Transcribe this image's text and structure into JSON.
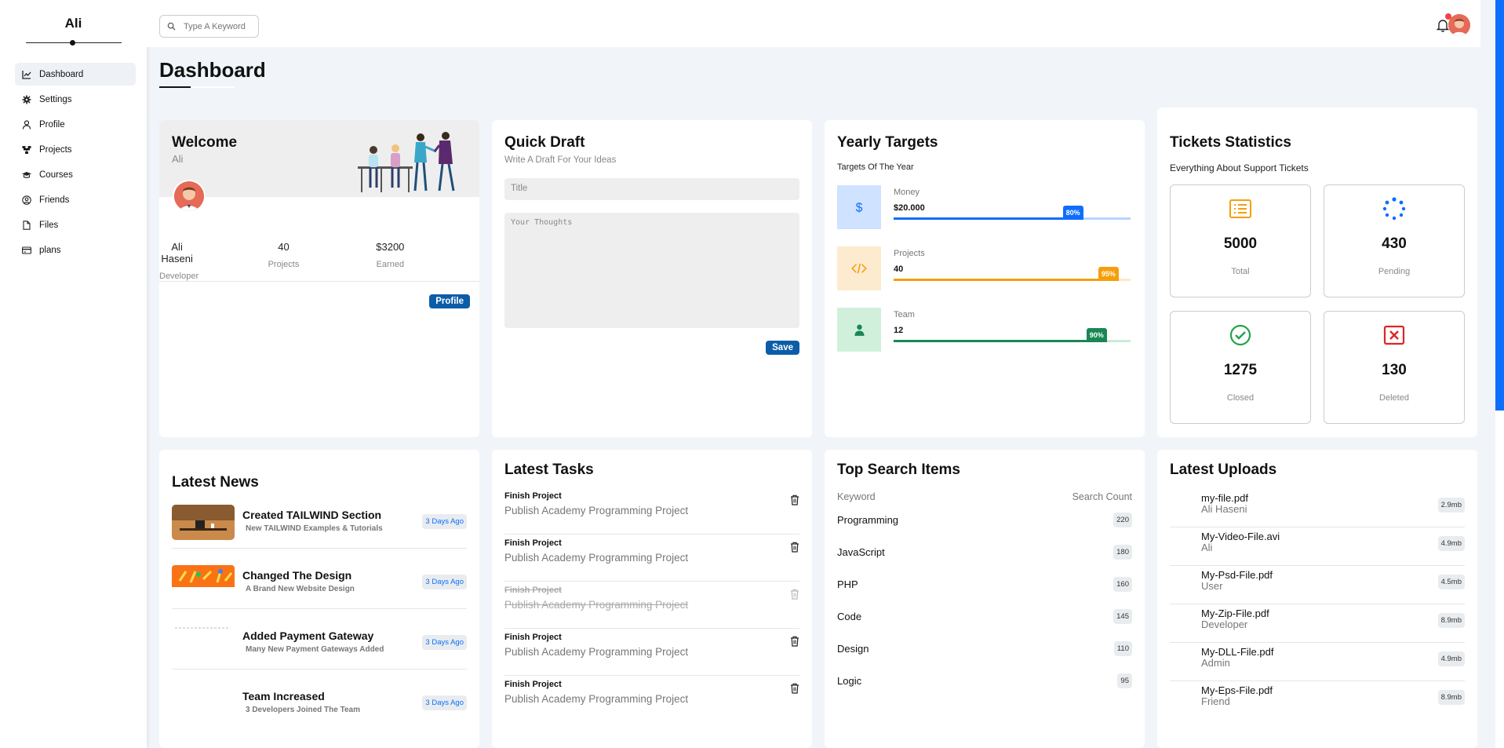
{
  "brand": {
    "name": "Ali"
  },
  "sidebar": {
    "items": [
      {
        "label": "Dashboard",
        "icon": "chart-line-icon",
        "active": true
      },
      {
        "label": "Settings",
        "icon": "gear-icon"
      },
      {
        "label": "Profile",
        "icon": "user-icon"
      },
      {
        "label": "Projects",
        "icon": "diagram-icon"
      },
      {
        "label": "Courses",
        "icon": "graduation-cap-icon"
      },
      {
        "label": "Friends",
        "icon": "user-circle-icon"
      },
      {
        "label": "Files",
        "icon": "file-icon"
      },
      {
        "label": "plans",
        "icon": "credit-card-icon"
      }
    ]
  },
  "header": {
    "search_placeholder": "Type A Keyword",
    "notification_badge": true
  },
  "page": {
    "title": "Dashboard"
  },
  "welcome": {
    "title": "Welcome",
    "subtitle": "Ali",
    "stats": [
      {
        "value": "Ali Haseni",
        "label": "Developer"
      },
      {
        "value": "40",
        "label": "Projects"
      },
      {
        "value": "$3200",
        "label": "Earned"
      }
    ],
    "button": "Profile"
  },
  "quick_draft": {
    "title": "Quick Draft",
    "subtitle": "Write A Draft For Your Ideas",
    "title_placeholder": "Title",
    "body_placeholder": "Your Thoughts",
    "button": "Save"
  },
  "targets": {
    "title": "Yearly Targets",
    "subtitle": "Targets Of The Year",
    "items": [
      {
        "name": "Money",
        "value": "$20.000",
        "percent": 80,
        "percent_label": "80%",
        "color": "#0d6efd",
        "track": "#b6d4fe",
        "bg": "#cfe2ff",
        "icon": "dollar-icon"
      },
      {
        "name": "Projects",
        "value": "40",
        "percent": 95,
        "percent_label": "95%",
        "color": "#f59e0b",
        "track": "#fde8c2",
        "bg": "#fdebd0",
        "icon": "code-icon"
      },
      {
        "name": "Team",
        "value": "12",
        "percent": 90,
        "percent_label": "90%",
        "color": "#198754",
        "track": "#c9ecd6",
        "bg": "#d1f0dc",
        "icon": "user-icon"
      }
    ]
  },
  "tickets": {
    "title": "Tickets Statistics",
    "subtitle": "Everything About Support Tickets",
    "items": [
      {
        "value": "5000",
        "label": "Total",
        "icon": "list-icon",
        "color": "#f59e0b"
      },
      {
        "value": "430",
        "label": "Pending",
        "icon": "spinner-icon",
        "color": "#0d6efd"
      },
      {
        "value": "1275",
        "label": "Closed",
        "icon": "check-circle-icon",
        "color": "#22a34a"
      },
      {
        "value": "130",
        "label": "Deleted",
        "icon": "x-square-icon",
        "color": "#dc2626"
      }
    ]
  },
  "news": {
    "title": "Latest News",
    "items": [
      {
        "title": "Created TAILWIND Section",
        "desc": "New TAILWIND Examples & Tutorials",
        "time": "3 Days Ago",
        "image": "desk-photo"
      },
      {
        "title": "Changed The Design",
        "desc": "A Brand New Website Design",
        "time": "3 Days Ago",
        "image": "orange-tools-photo"
      },
      {
        "title": "Added Payment Gateway",
        "desc": "Many New Payment Gateways Added",
        "time": "3 Days Ago",
        "image": "blank"
      },
      {
        "title": "Team Increased",
        "desc": "3 Developers Joined The Team",
        "time": "3 Days Ago",
        "image": "blank"
      }
    ]
  },
  "tasks": {
    "title": "Latest Tasks",
    "items": [
      {
        "title": "Finish Project",
        "desc": "Publish Academy Programming Project",
        "done": false
      },
      {
        "title": "Finish Project",
        "desc": "Publish Academy Programming Project",
        "done": false
      },
      {
        "title": "Finish Project",
        "desc": "Publish Academy Programming Project",
        "done": true
      },
      {
        "title": "Finish Project",
        "desc": "Publish Academy Programming Project",
        "done": false
      },
      {
        "title": "Finish Project",
        "desc": "Publish Academy Programming Project",
        "done": false
      }
    ]
  },
  "search_items": {
    "title": "Top Search Items",
    "col_keyword": "Keyword",
    "col_count": "Search Count",
    "items": [
      {
        "keyword": "Programming",
        "count": "220"
      },
      {
        "keyword": "JavaScript",
        "count": "180"
      },
      {
        "keyword": "PHP",
        "count": "160"
      },
      {
        "keyword": "Code",
        "count": "145"
      },
      {
        "keyword": "Design",
        "count": "110"
      },
      {
        "keyword": "Logic",
        "count": "95"
      }
    ]
  },
  "uploads": {
    "title": "Latest Uploads",
    "items": [
      {
        "file": "my-file.pdf",
        "owner": "Ali Haseni",
        "size": "2.9mb"
      },
      {
        "file": "My-Video-File.avi",
        "owner": "Ali",
        "size": "4.9mb"
      },
      {
        "file": "My-Psd-File.pdf",
        "owner": "User",
        "size": "4.5mb"
      },
      {
        "file": "My-Zip-File.pdf",
        "owner": "Developer",
        "size": "8.9mb"
      },
      {
        "file": "My-DLL-File.pdf",
        "owner": "Admin",
        "size": "4.9mb"
      },
      {
        "file": "My-Eps-File.pdf",
        "owner": "Friend",
        "size": "8.9mb"
      }
    ]
  }
}
